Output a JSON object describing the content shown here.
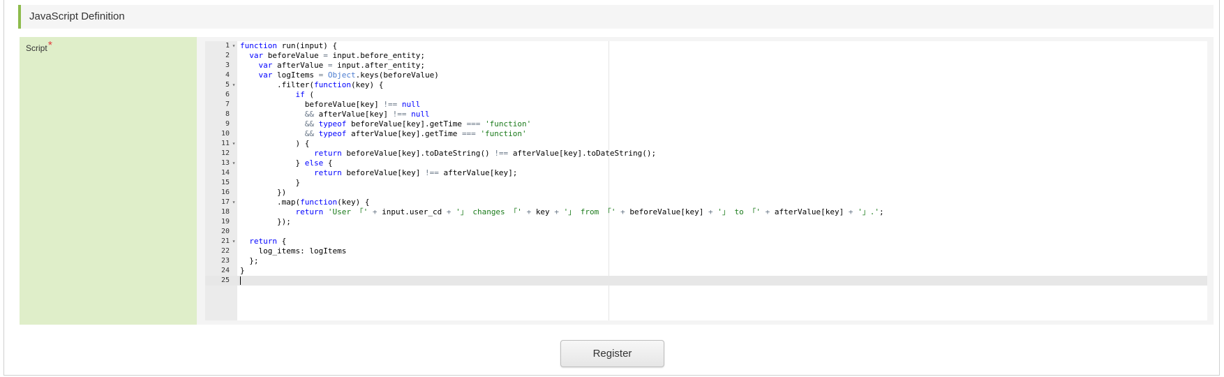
{
  "section": {
    "title": "JavaScript Definition"
  },
  "form": {
    "script_label": "Script",
    "required_mark": "*"
  },
  "editor": {
    "active_line": 25,
    "lines": [
      {
        "n": "1",
        "fold": true,
        "text": "function run(input) {"
      },
      {
        "n": "2",
        "fold": false,
        "text": "  var beforeValue = input.before_entity;"
      },
      {
        "n": "3",
        "fold": false,
        "text": "    var afterValue = input.after_entity;"
      },
      {
        "n": "4",
        "fold": false,
        "text": "    var logItems = Object.keys(beforeValue)"
      },
      {
        "n": "5",
        "fold": true,
        "text": "        .filter(function(key) {"
      },
      {
        "n": "6",
        "fold": false,
        "text": "            if ("
      },
      {
        "n": "7",
        "fold": false,
        "text": "              beforeValue[key] !== null"
      },
      {
        "n": "8",
        "fold": false,
        "text": "              && afterValue[key] !== null"
      },
      {
        "n": "9",
        "fold": false,
        "text": "              && typeof beforeValue[key].getTime === 'function'"
      },
      {
        "n": "10",
        "fold": false,
        "text": "              && typeof afterValue[key].getTime === 'function'"
      },
      {
        "n": "11",
        "fold": true,
        "text": "            ) {"
      },
      {
        "n": "12",
        "fold": false,
        "text": "                return beforeValue[key].toDateString() !== afterValue[key].toDateString();"
      },
      {
        "n": "13",
        "fold": true,
        "text": "            } else {"
      },
      {
        "n": "14",
        "fold": false,
        "text": "                return beforeValue[key] !== afterValue[key];"
      },
      {
        "n": "15",
        "fold": false,
        "text": "            }"
      },
      {
        "n": "16",
        "fold": false,
        "text": "        })"
      },
      {
        "n": "17",
        "fold": true,
        "text": "        .map(function(key) {"
      },
      {
        "n": "18",
        "fold": false,
        "text": "            return 'User 「' + input.user_cd + '」 changes 「' + key + '」 from 「' + beforeValue[key] + '」 to 「' + afterValue[key] + '」.';"
      },
      {
        "n": "19",
        "fold": false,
        "text": "        });"
      },
      {
        "n": "20",
        "fold": false,
        "text": ""
      },
      {
        "n": "21",
        "fold": true,
        "text": "  return {"
      },
      {
        "n": "22",
        "fold": false,
        "text": "    log_items: logItems"
      },
      {
        "n": "23",
        "fold": false,
        "text": "  };"
      },
      {
        "n": "24",
        "fold": false,
        "text": "}"
      },
      {
        "n": "25",
        "fold": false,
        "text": ""
      }
    ]
  },
  "actions": {
    "register_label": "Register"
  },
  "colors": {
    "accent_bar": "#8dbb4c",
    "label_bg": "#dfeec9",
    "required": "#e23c3c",
    "keyword": "#0000ff",
    "string": "#1a7a1a",
    "builtin": "#4a7bd0"
  }
}
